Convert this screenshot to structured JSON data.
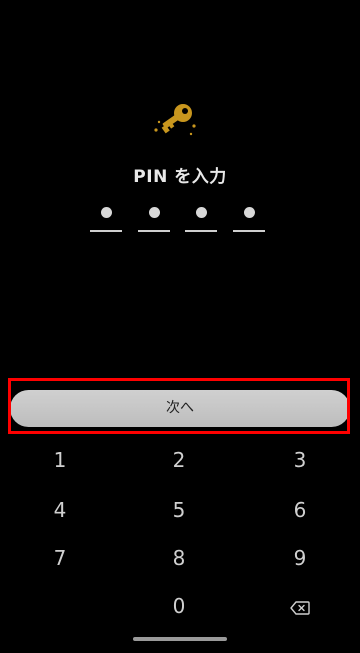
{
  "header": {
    "icon": "key-icon",
    "title": "PIN を入力"
  },
  "pin": {
    "length": 4,
    "filled": 4
  },
  "next_button": {
    "label": "次へ"
  },
  "keypad": {
    "keys": [
      "1",
      "2",
      "3",
      "4",
      "5",
      "6",
      "7",
      "8",
      "9",
      "",
      "0",
      "backspace"
    ],
    "backspace_icon": "backspace-icon"
  },
  "colors": {
    "background": "#000000",
    "key_icon": "#c8961e",
    "highlight": "#ff0000",
    "button": "#c8c8c8"
  }
}
